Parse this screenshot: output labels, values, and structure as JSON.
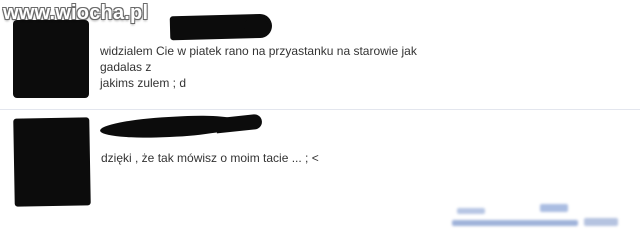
{
  "watermark": "www.wiocha.pl",
  "comments": [
    {
      "author": "",
      "text_line1": "widzialem Cie w piatek rano na przyastanku na starowie jak gadalas z",
      "text_line2": "jakims zulem ; d"
    },
    {
      "author": "",
      "text": "dzięki , że tak mówisz o moim tacie ... ; <"
    }
  ],
  "colors": {
    "text": "#333333",
    "redaction": "#0c0c0c",
    "divider": "#e3e6ee",
    "blurred_date": "#9fb3da"
  }
}
